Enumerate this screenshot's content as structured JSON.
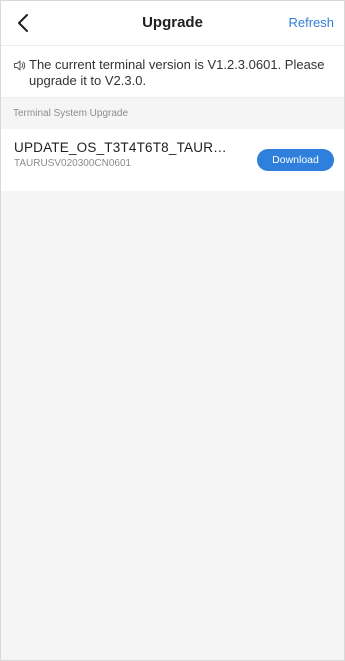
{
  "header": {
    "title": "Upgrade",
    "refresh_label": "Refresh",
    "back_icon": "chevron-left-icon"
  },
  "notice": {
    "icon": "speaker-icon",
    "text": "The current terminal version is V1.2.3.0601. Please upgrade it to V2.3.0."
  },
  "section": {
    "title": "Terminal System Upgrade"
  },
  "packages": [
    {
      "name": "UPDATE_OS_T3T4T6T8_TAURU...",
      "code": "TAURUSV020300CN0601",
      "action_label": "Download"
    }
  ],
  "colors": {
    "accent": "#2f7fdc",
    "background": "#f5f5f5"
  }
}
